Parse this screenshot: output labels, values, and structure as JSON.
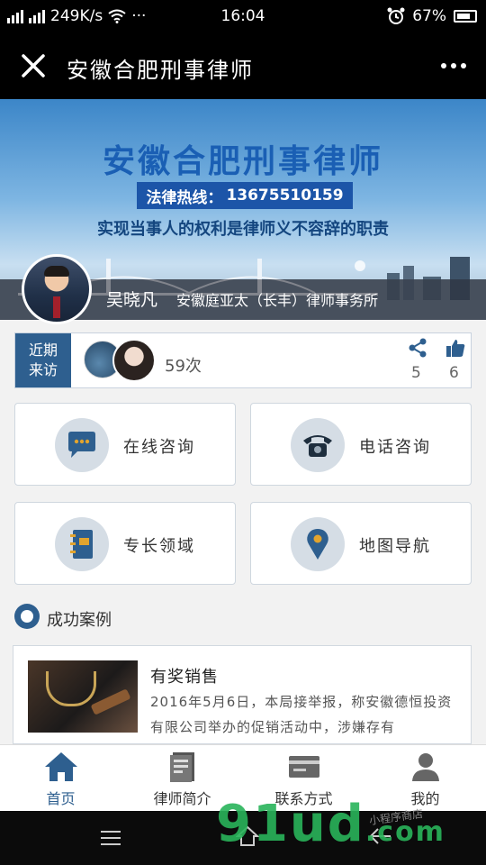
{
  "status_bar": {
    "network": "249K/s",
    "dots": "···",
    "time": "16:04",
    "battery": "67%"
  },
  "title_bar": {
    "title": "安徽合肥刑事律师",
    "close_icon": "close-icon",
    "more_icon": "more-dots-icon"
  },
  "banner": {
    "title": "安徽合肥刑事律师",
    "hotline_label": "法律热线：",
    "hotline_number": "13675510159",
    "slogan": "实现当事人的权利是律师义不容辞的职责"
  },
  "profile": {
    "name": "吴晓凡",
    "firm": "安徽庭亚太（长丰）律师事务所"
  },
  "visits": {
    "tag_line1": "近期",
    "tag_line2": "来访",
    "count": "59次",
    "shares": "5",
    "likes": "6"
  },
  "services": [
    {
      "label": "在线咨询",
      "icon": "chat-bubble-icon"
    },
    {
      "label": "电话咨询",
      "icon": "telephone-icon"
    },
    {
      "label": "专长领域",
      "icon": "notebook-icon"
    },
    {
      "label": "地图导航",
      "icon": "map-pin-icon"
    }
  ],
  "cases_section": {
    "title": "成功案例"
  },
  "case_item": {
    "title": "有奖销售",
    "body": "2016年5月6日，本局接举报，称安徽德恒投资有限公司举办的促销活动中，涉嫌存有"
  },
  "bottom_nav": [
    {
      "label": "首页",
      "icon": "home-icon"
    },
    {
      "label": "律师简介",
      "icon": "profile-document-icon"
    },
    {
      "label": "联系方式",
      "icon": "contact-card-icon"
    },
    {
      "label": "我的",
      "icon": "user-icon"
    }
  ],
  "watermark": {
    "brand": "91ud",
    "domain": ".com",
    "note": "小程序商店"
  },
  "colors": {
    "accent": "#2e5f8f",
    "banner_title": "#1a5fb4",
    "hotline_bg": "#1c55a8"
  }
}
